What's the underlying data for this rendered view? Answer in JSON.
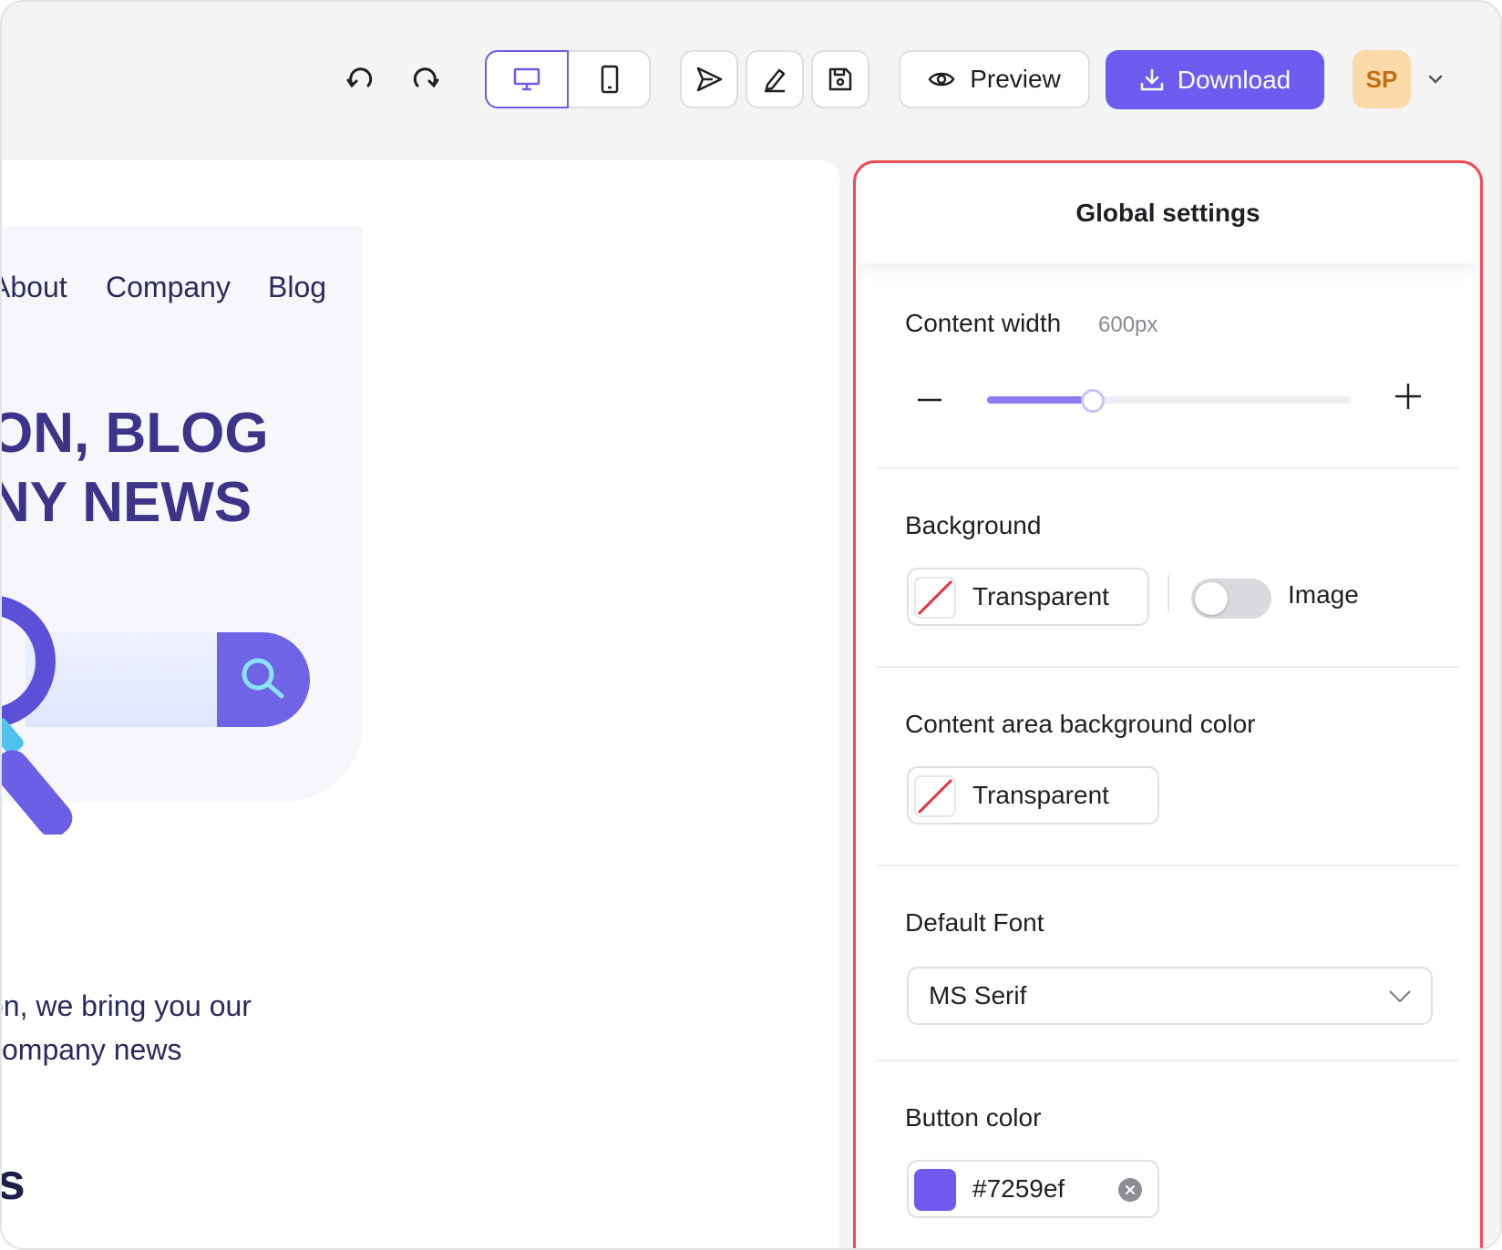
{
  "toolbar": {
    "undo_icon": "undo-icon",
    "redo_icon": "redo-icon",
    "device_desktop_icon": "desktop-icon",
    "device_mobile_icon": "mobile-icon",
    "send_icon": "send-icon",
    "edit_icon": "pencil-icon",
    "save_icon": "save-icon",
    "preview_label": "Preview",
    "download_label": "Download",
    "avatar_initials": "SP",
    "accent_color": "#6d5cef"
  },
  "canvas": {
    "nav": [
      "About",
      "Company",
      "Blog"
    ],
    "hero_title_line1": "ON, BLOG",
    "hero_title_line2": "NY NEWS",
    "body_line1": "on, we bring you our",
    "body_line2": "company news",
    "section_title": "ts"
  },
  "settings": {
    "title": "Global settings",
    "content_width_label": "Content width",
    "content_width_value": "600px",
    "content_width_slider_fraction": 0.29,
    "background_label": "Background",
    "background_value": "Transparent",
    "image_label": "Image",
    "image_toggle_on": false,
    "content_area_label": "Content area background color",
    "content_area_value": "Transparent",
    "default_font_label": "Default Font",
    "default_font_value": "MS Serif",
    "button_color_label": "Button color",
    "button_color_value": "#7259ef"
  }
}
